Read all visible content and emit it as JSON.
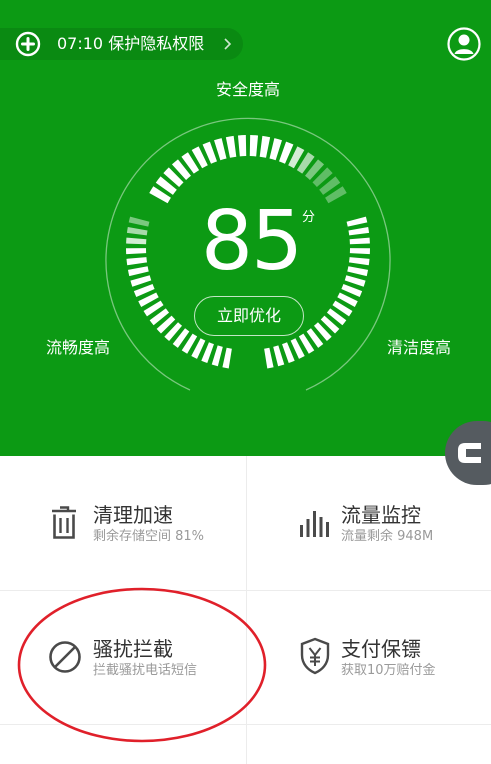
{
  "header": {
    "add_icon": "plus-circle-icon",
    "notice_text": "07:10 保护隐私权限",
    "chevron_icon": "chevron-right-icon",
    "profile_icon": "user-avatar-icon"
  },
  "gauge": {
    "top_label": "安全度高",
    "left_label": "流畅度高",
    "right_label": "清洁度高",
    "score": "85",
    "score_unit": "分",
    "optimize_button": "立即优化",
    "color_primary": "#0c9a14",
    "color_segment": "#ffffff"
  },
  "side_button": {
    "icon": "c-logo-icon"
  },
  "tiles": [
    {
      "icon": "trash-icon",
      "title": "清理加速",
      "subtitle": "剩余存储空间 81%"
    },
    {
      "icon": "signal-bars-icon",
      "title": "流量监控",
      "subtitle": "流量剩余 948M"
    },
    {
      "icon": "block-icon",
      "title": "骚扰拦截",
      "subtitle": "拦截骚扰电话短信"
    },
    {
      "icon": "shield-yen-icon",
      "title": "支付保镖",
      "subtitle": "获取10万赔付金"
    }
  ],
  "annotation": {
    "color": "#e0202a"
  }
}
